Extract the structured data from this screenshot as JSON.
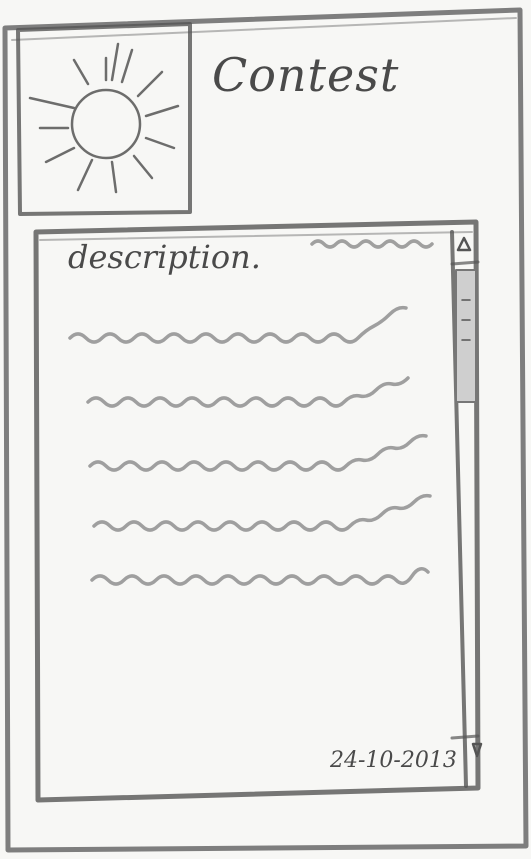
{
  "header": {
    "title": "Contest",
    "image_icon": "sun-icon"
  },
  "description": {
    "label": "description.",
    "date": "24-10-2013"
  },
  "scrollbar": {
    "up_icon": "triangle-up-icon",
    "down_icon": "triangle-down-icon"
  }
}
